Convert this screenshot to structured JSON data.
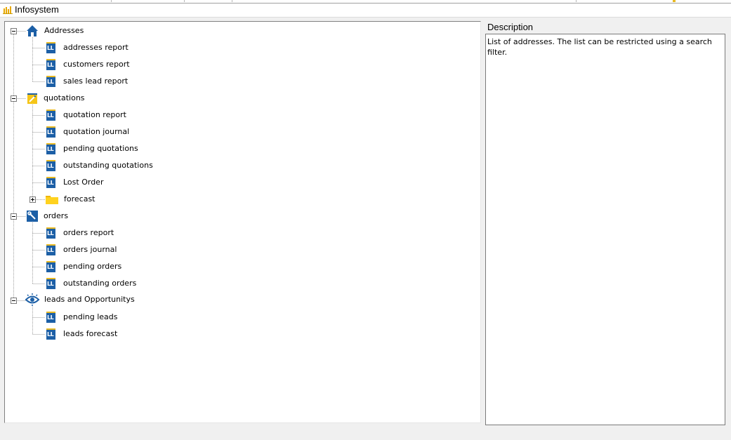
{
  "window": {
    "title": "Infosystem"
  },
  "tree": {
    "groups": [
      {
        "label": "Addresses",
        "icon": "house-icon",
        "items": [
          "addresses report",
          "customers report",
          "sales lead report"
        ]
      },
      {
        "label": "quotations",
        "icon": "pencil-note-icon",
        "items": [
          "quotation report",
          "quotation journal",
          "pending quotations",
          "outstanding quotations",
          "Lost Order"
        ],
        "folder": "forecast"
      },
      {
        "label": "orders",
        "icon": "wrench-icon",
        "items": [
          "orders report",
          "orders journal",
          "pending orders",
          "outstanding orders"
        ]
      },
      {
        "label": "leads and Opportunitys",
        "icon": "eye-icon",
        "items": [
          "pending leads",
          "leads forecast"
        ]
      }
    ],
    "report_icon_text": "LL"
  },
  "description": {
    "label": "Description",
    "text": "List of addresses. The list can be restricted using a search filter."
  },
  "colors": {
    "icon_blue": "#1c5fa6",
    "icon_gold": "#e8b923",
    "folder_yellow": "#ffd21f"
  }
}
